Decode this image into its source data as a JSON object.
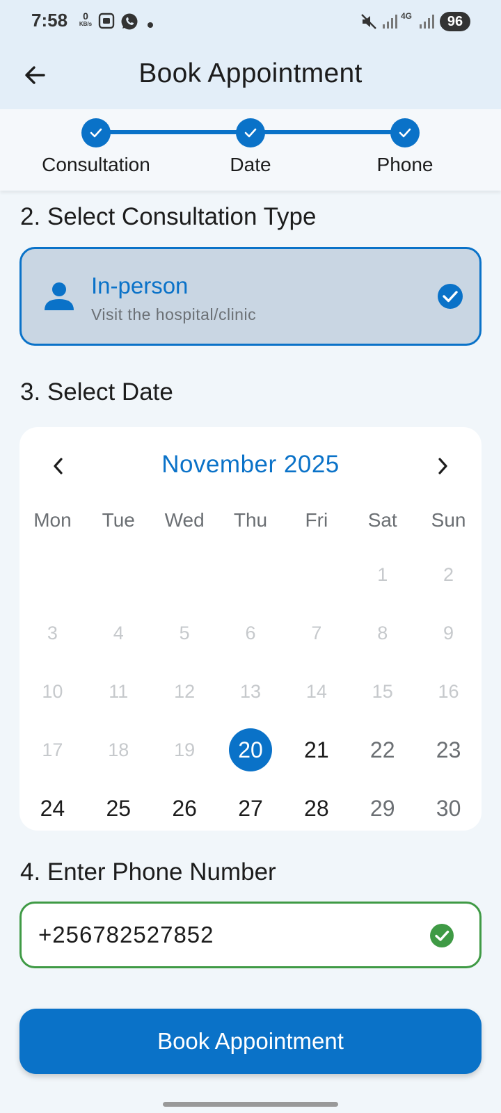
{
  "status_bar": {
    "time": "7:58",
    "speed_value": "0",
    "speed_unit": "KB/s",
    "network_label": "4G",
    "battery": "96",
    "icons": [
      "screenshot-icon",
      "whatsapp-icon",
      "dot-icon",
      "mute-icon",
      "signal-icon",
      "signal-icon"
    ]
  },
  "app_bar": {
    "title": "Book Appointment",
    "back_icon": "arrow-left-icon"
  },
  "stepper": {
    "steps": [
      {
        "label": "Consultation",
        "done": true
      },
      {
        "label": "Date",
        "done": true
      },
      {
        "label": "Phone",
        "done": true
      }
    ]
  },
  "consultation": {
    "section_title": "2. Select Consultation Type",
    "option": {
      "title": "In-person",
      "subtitle": "Visit the hospital/clinic",
      "icon": "person-icon",
      "selected": true
    }
  },
  "date": {
    "section_title": "3. Select Date",
    "month_label": "November 2025",
    "weekdays": [
      "Mon",
      "Tue",
      "Wed",
      "Thu",
      "Fri",
      "Sat",
      "Sun"
    ],
    "leading_blanks": 5,
    "days": [
      {
        "n": "1",
        "state": "disabled"
      },
      {
        "n": "2",
        "state": "disabled"
      },
      {
        "n": "3",
        "state": "disabled"
      },
      {
        "n": "4",
        "state": "disabled"
      },
      {
        "n": "5",
        "state": "disabled"
      },
      {
        "n": "6",
        "state": "disabled"
      },
      {
        "n": "7",
        "state": "disabled"
      },
      {
        "n": "8",
        "state": "disabled"
      },
      {
        "n": "9",
        "state": "disabled"
      },
      {
        "n": "10",
        "state": "disabled"
      },
      {
        "n": "11",
        "state": "disabled"
      },
      {
        "n": "12",
        "state": "disabled"
      },
      {
        "n": "13",
        "state": "disabled"
      },
      {
        "n": "14",
        "state": "disabled"
      },
      {
        "n": "15",
        "state": "disabled"
      },
      {
        "n": "16",
        "state": "disabled"
      },
      {
        "n": "17",
        "state": "disabled"
      },
      {
        "n": "18",
        "state": "disabled"
      },
      {
        "n": "19",
        "state": "disabled"
      },
      {
        "n": "20",
        "state": "selected"
      },
      {
        "n": "21",
        "state": "enabled"
      },
      {
        "n": "22",
        "state": "weekend"
      },
      {
        "n": "23",
        "state": "weekend"
      },
      {
        "n": "24",
        "state": "enabled"
      },
      {
        "n": "25",
        "state": "enabled"
      },
      {
        "n": "26",
        "state": "enabled"
      },
      {
        "n": "27",
        "state": "enabled"
      },
      {
        "n": "28",
        "state": "enabled"
      },
      {
        "n": "29",
        "state": "weekend"
      },
      {
        "n": "30",
        "state": "weekend"
      }
    ]
  },
  "phone": {
    "section_title": "4. Enter Phone Number",
    "value": "+256782527852",
    "valid": true
  },
  "submit": {
    "label": "Book Appointment"
  },
  "colors": {
    "primary": "#0a72c8",
    "success": "#3f9a45",
    "header_bg": "#e3eef8",
    "page_bg": "#f1f6fa",
    "selected_card_bg": "#c9d6e3"
  }
}
